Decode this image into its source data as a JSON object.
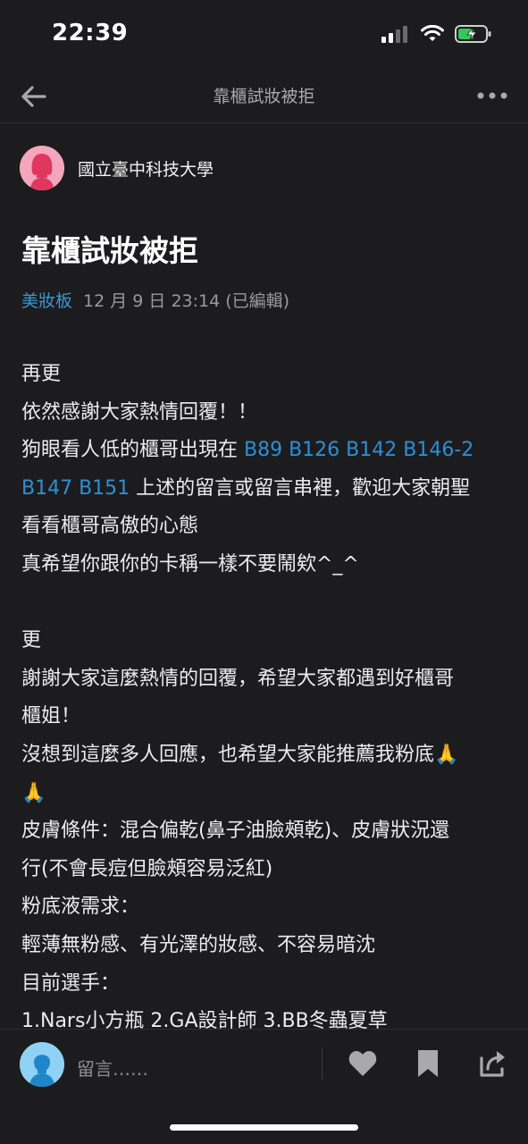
{
  "status": {
    "time": "22:39"
  },
  "nav": {
    "title": "靠櫃試妝被拒",
    "back_icon": "arrow-left-icon",
    "more_icon": "more-dots-icon"
  },
  "author": {
    "name": "國立臺中科技大學"
  },
  "post": {
    "title": "靠櫃試妝被拒",
    "board": "美妝板",
    "date": "12 月 9 日 23:14 (已編輯)",
    "body": {
      "l1": "再更",
      "l2": "依然感謝大家熱情回覆！！",
      "l3_text": "狗眼看人低的櫃哥出現在 ",
      "l3_links": "B89 B126 B142 B146-2",
      "l4_links": "B147 B151",
      "l4_text": " 上述的留言或留言串裡，歡迎大家朝聖",
      "l5": "看看櫃哥高傲的心態",
      "l6": "真希望你跟你的卡稱一樣不要鬧欸^_^",
      "l7": "更",
      "l8": "謝謝大家這麼熱情的回覆，希望大家都遇到好櫃哥",
      "l9": "櫃姐！",
      "l10": "沒想到這麼多人回應，也希望大家能推薦我粉底🙏",
      "l11": "🙏",
      "l12": "皮膚條件：混合偏乾(鼻子油臉頰乾)、皮膚狀況還",
      "l13": "行(不會長痘但臉頰容易泛紅)",
      "l14": "粉底液需求：",
      "l15": "輕薄無粉感、有光澤的妝感、不容易暗沈",
      "l16": "目前選手：",
      "l17": "1.Nars小方瓶 2.GA設計師 3.BB冬蟲夏草"
    }
  },
  "bottom_bar": {
    "comment_placeholder": "留言……"
  },
  "colors": {
    "background": "#1c1c1e",
    "link": "#2d8fd5",
    "board": "#3a97d4",
    "avatar_author": "#f4a6be",
    "avatar_user": "#8fd2f5"
  }
}
